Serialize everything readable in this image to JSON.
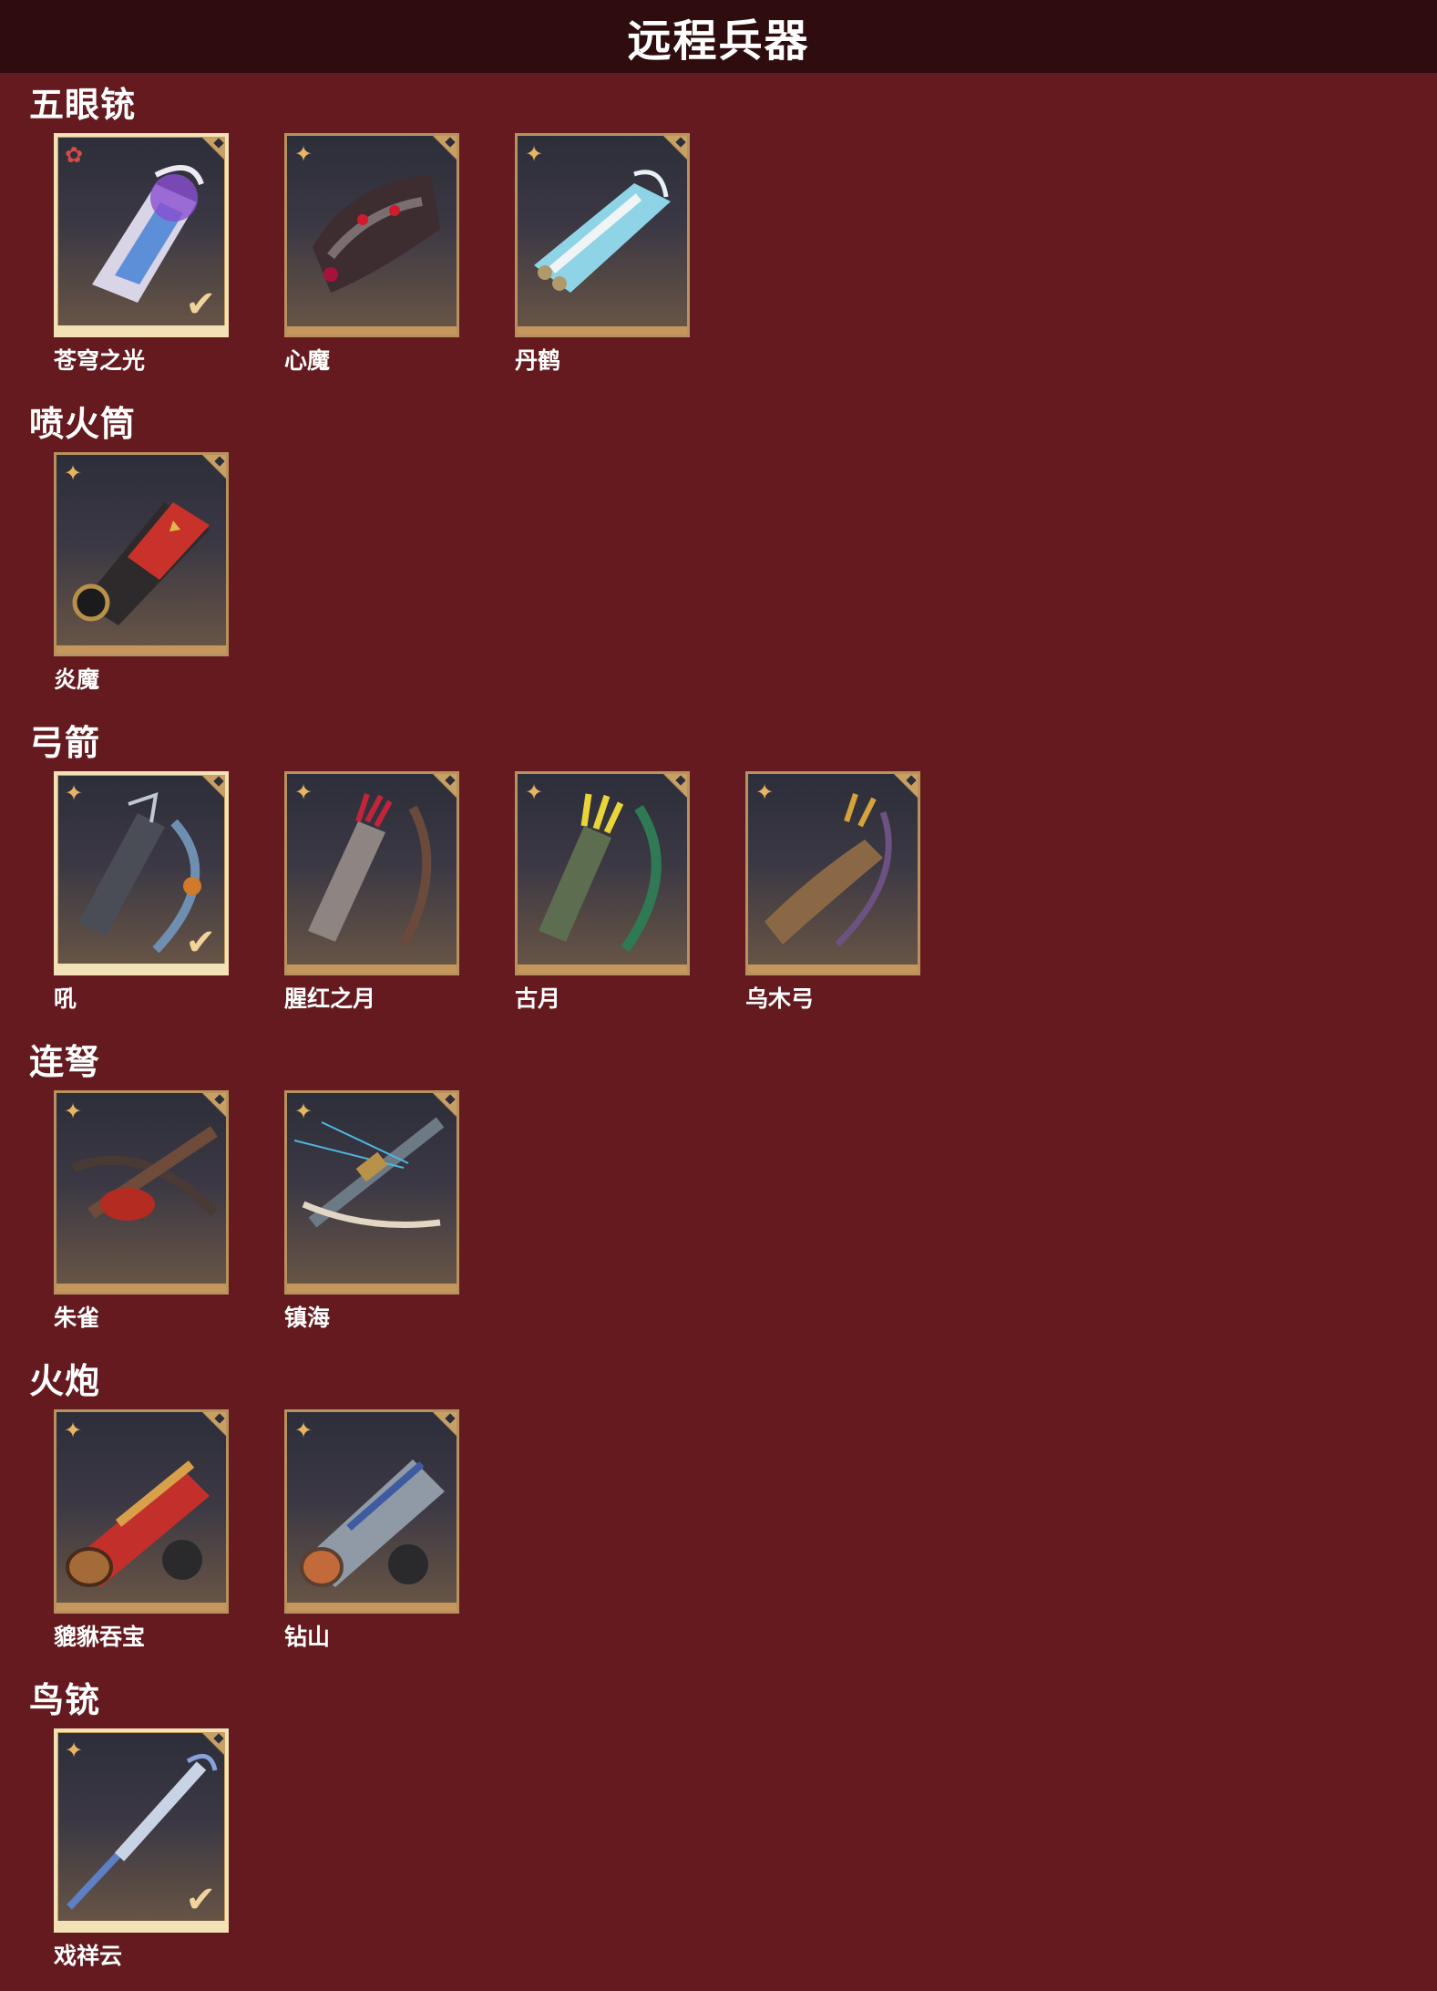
{
  "header": {
    "title": "远程兵器"
  },
  "colors": {
    "background": "#641a1e",
    "header": "#2f0d0f",
    "frame": "#b8925e",
    "equipped_frame": "#f3e2b6"
  },
  "sections": [
    {
      "title": "五眼铳",
      "items": [
        {
          "name": "苍穹之光",
          "rarity_icon": "red-flower-icon",
          "equipped": true
        },
        {
          "name": "心魔",
          "rarity_icon": "gold-star-icon",
          "equipped": false
        },
        {
          "name": "丹鹤",
          "rarity_icon": "gold-star-icon",
          "equipped": false
        }
      ]
    },
    {
      "title": "喷火筒",
      "items": [
        {
          "name": "炎魔",
          "rarity_icon": "gold-star-icon",
          "equipped": false
        }
      ]
    },
    {
      "title": "弓箭",
      "items": [
        {
          "name": "吼",
          "rarity_icon": "gold-star-icon",
          "equipped": true
        },
        {
          "name": "腥红之月",
          "rarity_icon": "gold-star-icon",
          "equipped": false
        },
        {
          "name": "古月",
          "rarity_icon": "gold-star-icon",
          "equipped": false
        },
        {
          "name": "乌木弓",
          "rarity_icon": "gold-star-icon",
          "equipped": false
        }
      ]
    },
    {
      "title": "连弩",
      "items": [
        {
          "name": "朱雀",
          "rarity_icon": "gold-star-icon",
          "equipped": false
        },
        {
          "name": "镇海",
          "rarity_icon": "gold-star-icon",
          "equipped": false
        }
      ]
    },
    {
      "title": "火炮",
      "items": [
        {
          "name": "貔貅吞宝",
          "rarity_icon": "gold-star-icon",
          "equipped": false
        },
        {
          "name": "钻山",
          "rarity_icon": "gold-star-icon",
          "equipped": false
        }
      ]
    },
    {
      "title": "鸟铳",
      "items": [
        {
          "name": "戏祥云",
          "rarity_icon": "gold-star-icon",
          "equipped": true
        }
      ]
    }
  ]
}
